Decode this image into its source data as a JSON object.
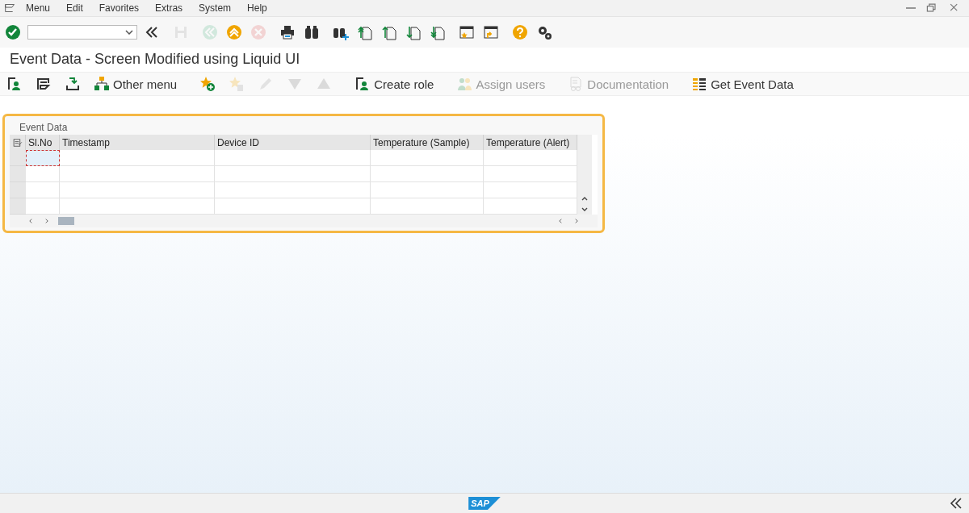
{
  "menu_bar": {
    "items": [
      "Menu",
      "Edit",
      "Favorites",
      "Extras",
      "System",
      "Help"
    ]
  },
  "toolbar": {
    "buttons": [
      {
        "kind": "enter",
        "disabled": false
      },
      {
        "kind": "command-field",
        "disabled": false
      },
      {
        "kind": "collapse",
        "disabled": false
      },
      {
        "kind": "save",
        "disabled": true
      },
      {
        "kind": "back",
        "disabled": true
      },
      {
        "kind": "exit",
        "disabled": false
      },
      {
        "kind": "cancel",
        "disabled": true
      },
      {
        "kind": "print",
        "disabled": false
      },
      {
        "kind": "find",
        "disabled": false
      },
      {
        "kind": "find-next",
        "disabled": false
      },
      {
        "kind": "first-page",
        "disabled": false
      },
      {
        "kind": "previous-page",
        "disabled": false
      },
      {
        "kind": "next-page",
        "disabled": false
      },
      {
        "kind": "last-page",
        "disabled": false
      },
      {
        "kind": "new-session",
        "disabled": false
      },
      {
        "kind": "shortcut",
        "disabled": false
      },
      {
        "kind": "help",
        "disabled": false
      },
      {
        "kind": "settings",
        "disabled": false
      }
    ]
  },
  "title": "Event Data  - Screen Modified using Liquid UI",
  "app_toolbar": {
    "items": [
      {
        "kind": "user",
        "disabled": false
      },
      {
        "kind": "edit",
        "disabled": false
      },
      {
        "kind": "download",
        "disabled": false
      },
      {
        "kind": "hierarchy",
        "label": "Other menu",
        "disabled": false
      },
      {
        "kind": "add-favorite",
        "disabled": false
      },
      {
        "kind": "delete-favorite",
        "disabled": true
      },
      {
        "kind": "pencil",
        "disabled": true
      },
      {
        "kind": "down",
        "disabled": true
      },
      {
        "kind": "up",
        "disabled": true
      },
      {
        "kind": "user",
        "label": "Create role",
        "disabled": false
      },
      {
        "kind": "users",
        "label": "Assign users",
        "disabled": true
      },
      {
        "kind": "documentation",
        "label": "Documentation",
        "disabled": true
      },
      {
        "kind": "list",
        "label": "Get Event Data",
        "disabled": false
      }
    ]
  },
  "table": {
    "title": "Event Data",
    "columns": [
      "Sl.No",
      "Timestamp",
      "Device ID",
      "Temperature (Sample)",
      "Temperature (Alert)"
    ]
  },
  "status_bar": {
    "logo": "SAP"
  }
}
